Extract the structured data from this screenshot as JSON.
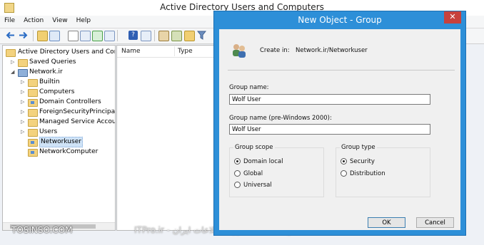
{
  "main_window": {
    "title": "Active Directory Users and Computers",
    "menu": [
      "File",
      "Action",
      "View",
      "Help"
    ],
    "tree": {
      "root": "Active Directory Users and Com",
      "items": [
        {
          "label": "Saved Queries",
          "type": "folder"
        },
        {
          "label": "Network.ir",
          "type": "domain"
        },
        {
          "label": "Builtin",
          "type": "folder"
        },
        {
          "label": "Computers",
          "type": "folder"
        },
        {
          "label": "Domain Controllers",
          "type": "ou"
        },
        {
          "label": "ForeignSecurityPrincipals",
          "type": "folder"
        },
        {
          "label": "Managed Service Accour",
          "type": "folder"
        },
        {
          "label": "Users",
          "type": "folder"
        },
        {
          "label": "Networkuser",
          "type": "ou",
          "selected": true
        },
        {
          "label": "NetworkComputer",
          "type": "ou"
        }
      ]
    },
    "list_columns": [
      "Name",
      "Type"
    ]
  },
  "dialog": {
    "title": "New Object - Group",
    "close_glyph": "✕",
    "create_in_label": "Create in:",
    "create_in_value": "Network.ir/Networkuser",
    "group_name_label": "Group name:",
    "group_name_value": "Wolf User",
    "group_name_pre2000_label": "Group name (pre-Windows 2000):",
    "group_name_pre2000_value": "Wolf User",
    "group_scope": {
      "title": "Group scope",
      "options": [
        "Domain local",
        "Global",
        "Universal"
      ],
      "selected": "Domain local"
    },
    "group_type": {
      "title": "Group type",
      "options": [
        "Security",
        "Distribution"
      ],
      "selected": "Security"
    },
    "ok_label": "OK",
    "cancel_label": "Cancel"
  },
  "watermarks": {
    "left": "TOSINSO.COM",
    "center": "ITPro.ir - انجمن تخصصی فناوری اطلاعات ایران"
  },
  "colors": {
    "dialog_frame": "#2d8fd8",
    "close_button": "#c7413d",
    "folder": "#f3d27e"
  }
}
